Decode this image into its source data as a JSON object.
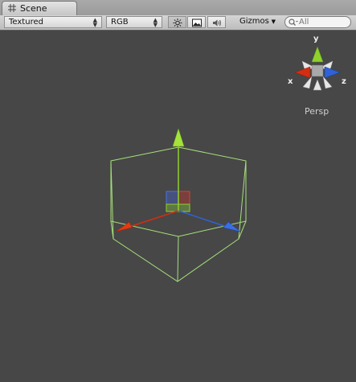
{
  "window": {
    "tab_label": "Scene",
    "tab_icon": "grid-icon"
  },
  "toolbar": {
    "render_mode": "Textured",
    "color_mode": "RGB",
    "lighting_icon": "sun-icon",
    "image_icon": "image-icon",
    "audio_icon": "speaker-icon",
    "gizmos_label": "Gizmos",
    "search_placeholder": "All"
  },
  "scene": {
    "orientation_gizmo": {
      "y_label": "y",
      "x_label": "x",
      "z_label": "z"
    },
    "projection_label": "Persp",
    "object": "cube-wireframe-with-move-handles"
  },
  "colors": {
    "viewport_bg": "#474747",
    "axis_x": "#d52d12",
    "axis_y": "#8fd12c",
    "axis_z": "#2f62d8",
    "wireframe": "#a6e07a"
  }
}
